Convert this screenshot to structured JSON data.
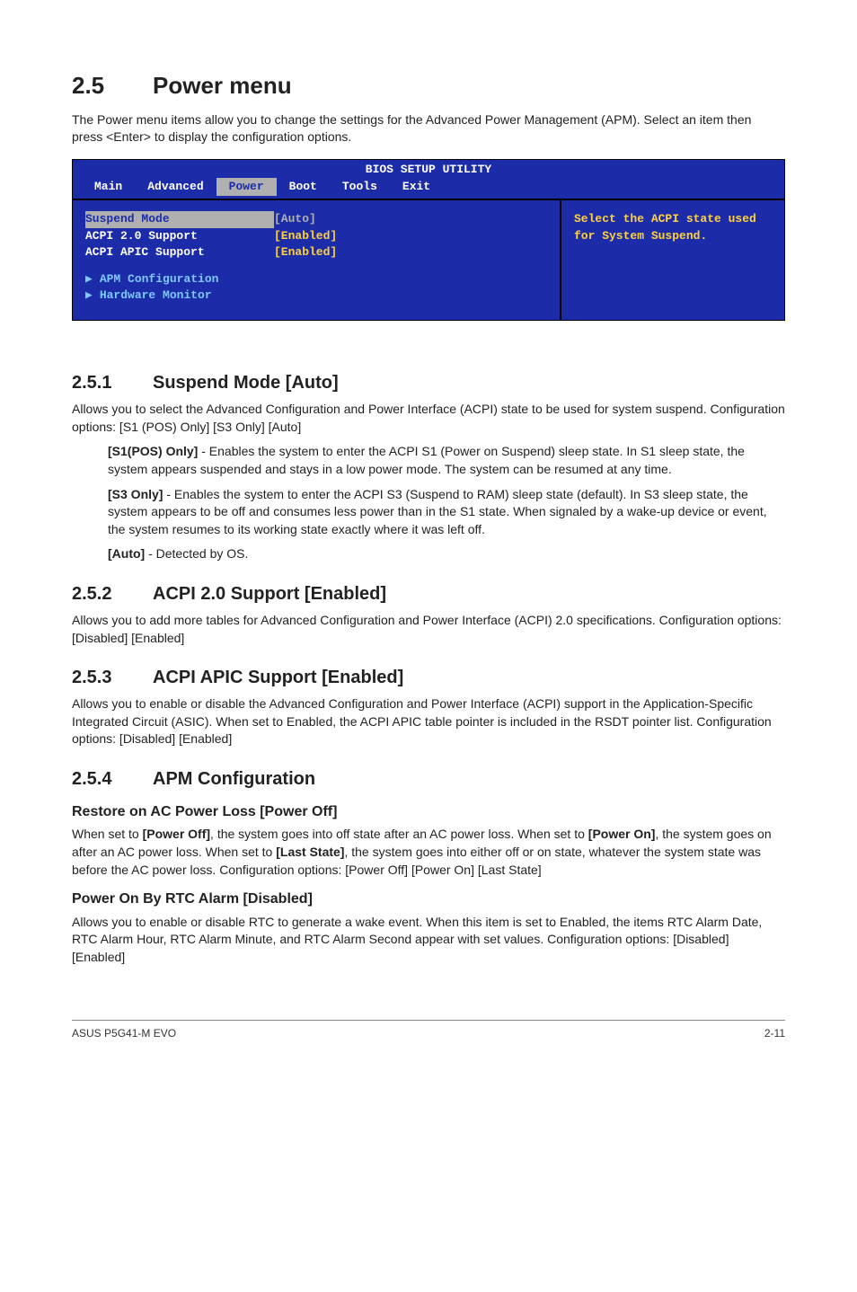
{
  "section": {
    "num": "2.5",
    "title": "Power menu"
  },
  "intro": "The Power menu items allow you to change the settings for the Advanced Power Management (APM). Select an item then press <Enter> to display the configuration options.",
  "bios": {
    "header": "BIOS SETUP UTILITY",
    "tabs": [
      "Main",
      "Advanced",
      "Power",
      "Boot",
      "Tools",
      "Exit"
    ],
    "active_tab": "Power",
    "rows": [
      {
        "label": "Suspend Mode",
        "value": "[Auto]",
        "hl": true
      },
      {
        "label": "ACPI 2.0 Support",
        "value": "[Enabled]"
      },
      {
        "label": "ACPI APIC Support",
        "value": "[Enabled]"
      }
    ],
    "subitems": [
      "APM Configuration",
      "Hardware Monitor"
    ],
    "help": "Select the ACPI state used for System Suspend."
  },
  "s251": {
    "num": "2.5.1",
    "title": "Suspend Mode [Auto]",
    "p": "Allows you to select the Advanced Configuration and Power Interface (ACPI) state to be used for system suspend. Configuration options: [S1 (POS) Only] [S3 Only] [Auto]",
    "b1_label": "[S1(POS) Only]",
    "b1_text": " - Enables the system to enter the ACPI S1 (Power on Suspend) sleep state. In S1 sleep state, the system appears suspended and stays in a low power mode. The system can be resumed at any time.",
    "b2_label": "[S3 Only]",
    "b2_text": " - Enables the system to enter the ACPI S3 (Suspend to RAM) sleep state (default). In S3 sleep state, the system appears to be off and consumes less power than in the S1 state. When signaled by a wake-up device or event, the system resumes to its working state exactly where it was left off.",
    "b3_label": "[Auto]",
    "b3_text": " - Detected by OS."
  },
  "s252": {
    "num": "2.5.2",
    "title": "ACPI 2.0 Support [Enabled]",
    "p": "Allows you to add more tables for Advanced Configuration and Power Interface (ACPI) 2.0 specifications. Configuration options: [Disabled] [Enabled]"
  },
  "s253": {
    "num": "2.5.3",
    "title": "ACPI APIC Support [Enabled]",
    "p": "Allows you to enable or disable the Advanced Configuration and Power Interface (ACPI) support in the Application-Specific Integrated Circuit (ASIC). When set to Enabled, the ACPI APIC table pointer is included in the RSDT pointer list. Configuration options: [Disabled] [Enabled]"
  },
  "s254": {
    "num": "2.5.4",
    "title": "APM Configuration",
    "h1": "Restore on AC Power Loss [Power Off]",
    "p1a": "When set to ",
    "p1b": "[Power Off]",
    "p1c": ", the system goes into off state after an AC power loss. When set to ",
    "p1d": "[Power On]",
    "p1e": ", the system goes on after an AC power loss. When set to ",
    "p1f": "[Last State]",
    "p1g": ", the system goes into either off or on state, whatever the system state was before the AC power loss. Configuration options: [Power Off] [Power On] [Last State]",
    "h2": "Power On By RTC Alarm [Disabled]",
    "p2": "Allows you to enable or disable RTC to generate a wake event. When this item is set to Enabled, the items RTC Alarm Date, RTC Alarm Hour, RTC Alarm Minute, and RTC Alarm Second appear with set values. Configuration options: [Disabled] [Enabled]"
  },
  "footer": {
    "left": "ASUS P5G41-M EVO",
    "right": "2-11"
  }
}
